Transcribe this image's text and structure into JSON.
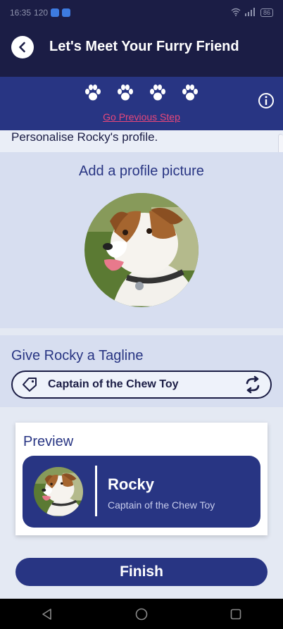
{
  "status_bar": {
    "time": "16:35",
    "speed": "120",
    "battery": "86"
  },
  "header": {
    "title": "Let's Meet Your Furry Friend",
    "back_icon": "chevron-left-icon"
  },
  "stepper": {
    "steps": [
      "paw",
      "paw",
      "paw",
      "paw"
    ],
    "prev_step_label": "Go Previous Step",
    "info_icon": "info-icon"
  },
  "intro": {
    "text": "Personalise Rocky's profile."
  },
  "photo": {
    "heading": "Add a profile picture"
  },
  "tagline": {
    "heading": "Give Rocky a Tagline",
    "value": "Captain of the Chew Toy"
  },
  "preview": {
    "label": "Preview",
    "name": "Rocky",
    "tagline": "Captain of the Chew Toy"
  },
  "finish_label": "Finish",
  "colors": {
    "header_bg": "#1b1d45",
    "accent": "#283583",
    "link": "#e8477a",
    "section_bg": "#d7def0"
  }
}
